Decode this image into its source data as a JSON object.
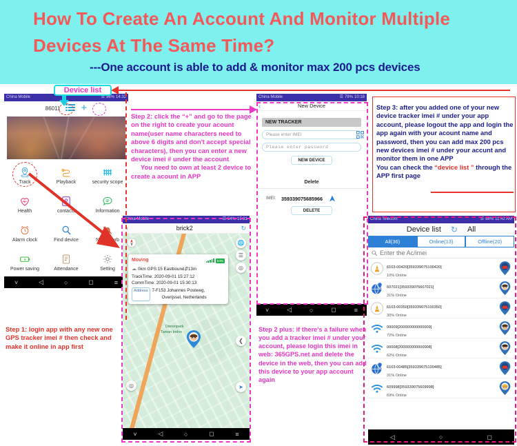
{
  "header": {
    "title": "How To Create An Account And Monitor Multiple Devices At The Same Time?",
    "subtitle": "---One account is able to add & monitor max 200 pcs devices",
    "title_color": "#f4595a",
    "subtitle_color": "#1b1b8f",
    "bg_color": "#7ef0ee"
  },
  "callouts": {
    "device_list_label": "Device list",
    "step1": "Step 1: login app with any new one GPS tracker imei # then check and make it online in app first",
    "step2": "Step 2: click the “+” and go to the page on the right to create your acount name(user name characters need to above 6 digits and don't accept special characters), then you can enter a new device imei # under the account",
    "step2_extra": "You need to own at least 2 device to create a acount in APP",
    "step2plus": "Step 2 plus: if there's a failure when you add a tracker imei # under your account, please login this imei in web: 365GPS.net and delete the device in the web, then you can add this device to your app account again",
    "step3": "Step 3: after you added one of your new device tracker imei # under your app account, please logout the app and login the app again with your acount name and password, then you can add max 200 pcs new devices imei # under your accunt and monitor them in one APP",
    "step3_extra_pre": "You can check the ",
    "step3_extra_hl": "“device list ”",
    "step3_extra_post": " through the APP first page"
  },
  "phone_home": {
    "status": {
      "carrier": "China Mobile",
      "battery": "96%",
      "time": "14:32"
    },
    "device_id": "86011",
    "list_icon": "list-icon",
    "add_icon": "plus-icon",
    "grid": [
      {
        "label": "Track",
        "icon": "location-pin-icon"
      },
      {
        "label": "Playback",
        "icon": "route-icon"
      },
      {
        "label": "security scope",
        "icon": "fence-icon"
      },
      {
        "label": "Health",
        "icon": "heart-icon"
      },
      {
        "label": "contacts",
        "icon": "contacts-icon"
      },
      {
        "label": "Information",
        "icon": "message-icon"
      },
      {
        "label": "Alarm clock",
        "icon": "alarm-clock-icon"
      },
      {
        "label": "Find device",
        "icon": "magnifier-icon"
      },
      {
        "label": "Not disturb",
        "icon": "bell-off-icon"
      },
      {
        "label": "Power saving",
        "icon": "battery-icon"
      },
      {
        "label": "Attendance",
        "icon": "attendance-icon"
      },
      {
        "label": "Setting",
        "icon": "gear-icon"
      }
    ]
  },
  "phone_map": {
    "status": {
      "carrier": "China Mobile",
      "battery": "54%",
      "time": "15:31"
    },
    "title": "brick2",
    "back_icon": "chevron-left-icon",
    "refresh_icon": "refresh-icon",
    "popup": {
      "state": "Moving",
      "battery": "84%",
      "summary": "0km GPS:15 Eastbound⇵13m",
      "track_time": "TrackTime: 2020-09-01 15:27:12",
      "comm_time": "CommTime: 2020-09-01 15:30:13",
      "address_label": "Address",
      "address_line1": "7-F153 Johannes Postweg,",
      "address_line2": "Overijssel, Netherlands"
    },
    "map_labels": [
      "Dierenpark",
      "Taman Indon"
    ],
    "fabs": [
      "globe-icon",
      "layers-icon",
      "locate-icon",
      "share-icon",
      "navigate-icon"
    ]
  },
  "phone_new_device": {
    "status": {
      "carrier": "China Mobile",
      "battery": "79%",
      "time": "10:18"
    },
    "title": "New Device",
    "back_icon": "chevron-left-icon",
    "section_tracker": "NEW TRACKER",
    "imei_placeholder": "Please enter IMEI",
    "password_placeholder": "Please enter password",
    "qr_icon": "qr-code-icon",
    "new_device_button": "NEW DEVICE",
    "delete_title": "Delete",
    "imei_label": "IMEI:",
    "imei_value": "359339075685966",
    "delete_button": "DELETE",
    "arrow_icon": "navigate-icon"
  },
  "phone_device_list": {
    "status": {
      "carrier": "China Telecom",
      "battery": "88%",
      "time": "11:42 AM"
    },
    "title": "Device list",
    "refresh_icon": "refresh-icon",
    "filter_label": "All",
    "tabs": [
      {
        "label": "All(36)",
        "active": true
      },
      {
        "label": "Online(13)",
        "active": false
      },
      {
        "label": "Offline(20)",
        "active": false
      }
    ],
    "search_placeholder": "Enter the Ac/imei",
    "search_icon": "search-icon",
    "rows": [
      {
        "imei": "6103-00420[359339075100420]",
        "status": "10%  Online",
        "icon": "tower-icon",
        "avatar": "car-avatar"
      },
      {
        "imei": "607021[359339075607021]",
        "status": "31%  Online",
        "icon": "globe-pin-icon",
        "avatar": "boy-avatar"
      },
      {
        "imei": "6103-00350[359339075100350]",
        "status": "30%  Online",
        "icon": "tower-icon",
        "avatar": "car-avatar"
      },
      {
        "imei": "00009[200000000000009]",
        "status": "72%  Online",
        "icon": "wifi-icon",
        "avatar": "boy-avatar"
      },
      {
        "imei": "00008[200000000000008]",
        "status": "62%  Online",
        "icon": "wifi-icon",
        "avatar": "boy-avatar"
      },
      {
        "imei": "6103-00485[359339075100485]",
        "status": "31%  Online",
        "icon": "globe-pin-icon",
        "avatar": "car-avatar"
      },
      {
        "imei": "609998[359339075609998]",
        "status": "69%  Online",
        "icon": "wifi-icon",
        "avatar": "girl-avatar"
      }
    ]
  }
}
